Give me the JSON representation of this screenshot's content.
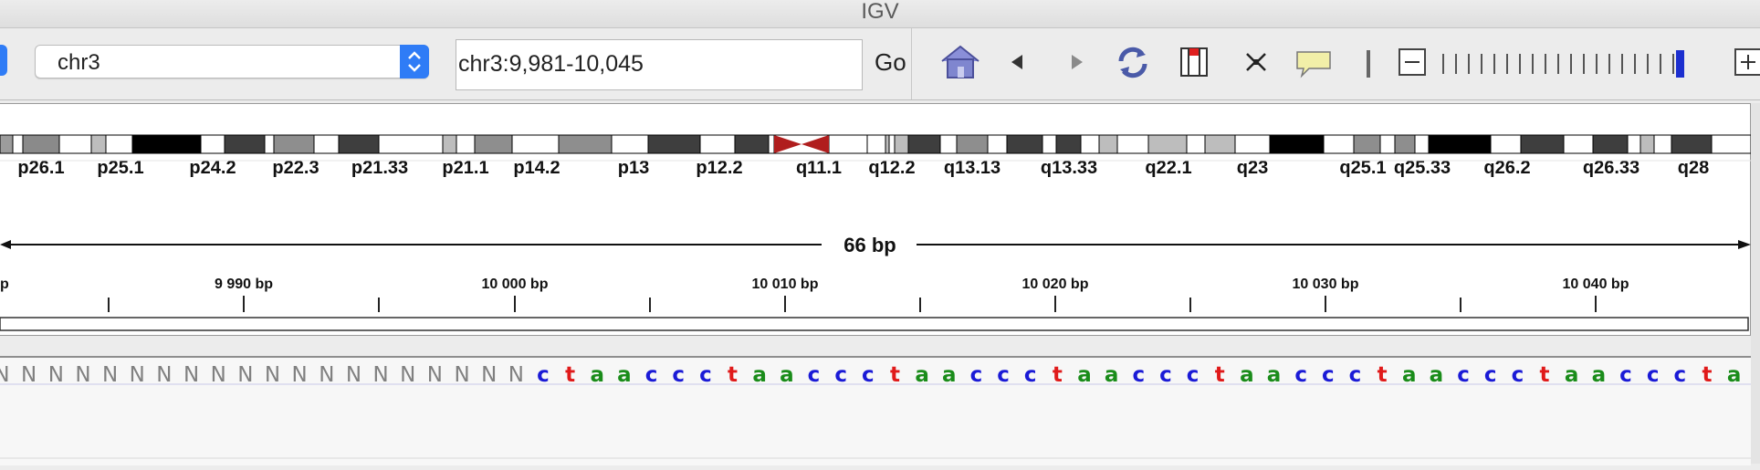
{
  "window": {
    "title": "IGV"
  },
  "toolbar": {
    "genome": "chr3",
    "locus": "chr3:9,981-10,045",
    "go_label": "Go",
    "icons": [
      "home-icon",
      "back-arrow-icon",
      "forward-arrow-icon",
      "refresh-icon",
      "region-of-interest-icon",
      "resize-to-window-icon",
      "popup-text-behavior-icon"
    ],
    "zoom": {
      "ticks": 19,
      "current_index": 18
    }
  },
  "ideogram": {
    "bands": [
      "p26.1",
      "p25.1",
      "p24.2",
      "p22.3",
      "p21.33",
      "p21.1",
      "p14.2",
      "p13",
      "p12.2",
      "q11.1",
      "q12.2",
      "q13.13",
      "q13.33",
      "q22.1",
      "q23",
      "q25.1",
      "q25.33",
      "q26.2",
      "q26.33",
      "q28"
    ],
    "centromere_color": "#b01e1e"
  },
  "ruler": {
    "span_label": "66 bp",
    "left_partial_label": "p",
    "tick_labels": [
      "9 990 bp",
      "10 000 bp",
      "10 010 bp",
      "10 020 bp",
      "10 030 bp",
      "10 040 bp"
    ]
  },
  "sequence": {
    "bases": "NNNNNNNNNNNNNNNNNNNNctaaccctaaccctaaccctaaccctaaccctaaccctaaccctaaccctaacccta",
    "colors": {
      "a": "#1a8c1a",
      "c": "#1a1ad6",
      "g": "#c97d00",
      "t": "#e01a1a",
      "N": "#808080"
    }
  }
}
